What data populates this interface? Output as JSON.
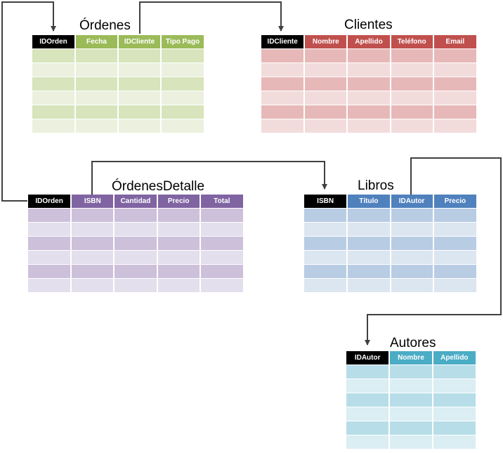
{
  "tables": {
    "ordenes": {
      "title": "Órdenes",
      "columns": [
        "IDOrden",
        "Fecha",
        "IDCliente",
        "Tipo Pago"
      ],
      "header_color": "#9bbb59",
      "row_colors": [
        "#d7e4bc",
        "#ebf1de"
      ]
    },
    "clientes": {
      "title": "Clientes",
      "columns": [
        "IDCliente",
        "Nombre",
        "Apellido",
        "Teléfono",
        "Email"
      ],
      "header_color": "#c0504d",
      "row_colors": [
        "#e6b9b8",
        "#f2dcdb"
      ]
    },
    "ordenesdetalle": {
      "title": "ÓrdenesDetalle",
      "columns": [
        "IDOrden",
        "ISBN",
        "Cantidad",
        "Precio",
        "Total"
      ],
      "header_color": "#8064a2",
      "row_colors": [
        "#ccc0da",
        "#e4dfec"
      ]
    },
    "libros": {
      "title": "Libros",
      "columns": [
        "ISBN",
        "Título",
        "IDAutor",
        "Precio"
      ],
      "header_color": "#4f81bd",
      "row_colors": [
        "#b8cce4",
        "#dce6f1"
      ]
    },
    "autores": {
      "title": "Autores",
      "columns": [
        "IDAutor",
        "Nombre",
        "Apellido"
      ],
      "header_color": "#4bacc6",
      "row_colors": [
        "#b7dee8",
        "#daeef3"
      ]
    }
  },
  "key_color": "#000000",
  "connector_color": "#404040"
}
